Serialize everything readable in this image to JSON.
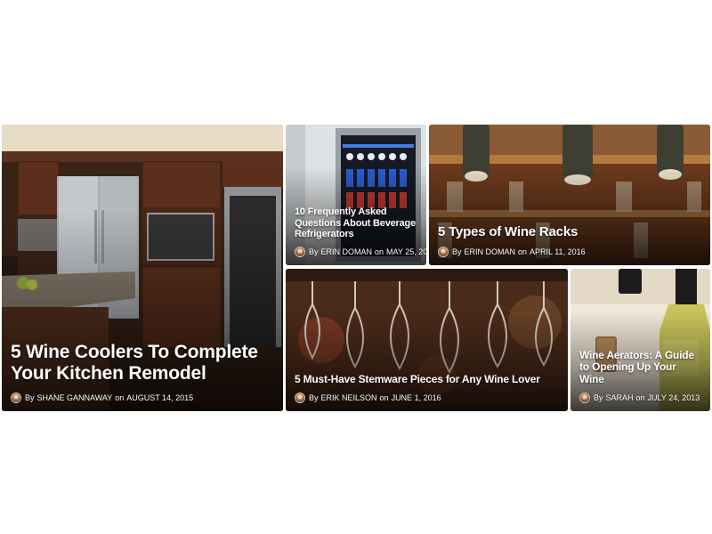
{
  "cards": [
    {
      "title": "5 Wine Coolers To Complete Your Kitchen Remodel",
      "by": "By",
      "author": "SHANE GANNAWAY",
      "on": "on",
      "date": "AUGUST 14, 2015",
      "avatar_icon": "author-avatar"
    },
    {
      "title": "10 Frequently Asked Questions About Beverage Refrigerators",
      "by": "By",
      "author": "ERIN DOMAN",
      "on": "on",
      "date": "MAY 25, 2016",
      "avatar_icon": "author-avatar"
    },
    {
      "title": "5 Types of Wine Racks",
      "by": "By",
      "author": "ERIN DOMAN",
      "on": "on",
      "date": "APRIL 11, 2016",
      "avatar_icon": "author-avatar"
    },
    {
      "title": "5 Must-Have Stemware Pieces for Any Wine Lover",
      "by": "By",
      "author": "ERIK NEILSON",
      "on": "on",
      "date": "JUNE 1, 2016",
      "avatar_icon": "author-avatar"
    },
    {
      "title": "Wine Aerators: A Guide to Opening Up Your Wine",
      "by": "By",
      "author": "SARAH",
      "on": "on",
      "date": "JULY 24, 2013",
      "avatar_icon": "author-avatar"
    }
  ]
}
